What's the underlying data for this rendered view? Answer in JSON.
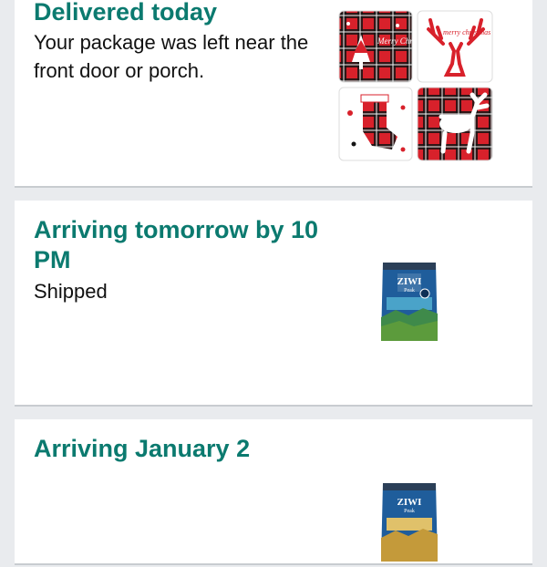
{
  "shipments": [
    {
      "status": "Delivered today",
      "detail": "Your package was left near the front door or porch.",
      "image": "christmas-pillow-covers"
    },
    {
      "status": "Arriving tomorrow by 10 PM",
      "detail": "Shipped",
      "image": "pet-food-bag-blue"
    },
    {
      "status": "Arriving January 2",
      "detail": "",
      "image": "pet-food-bag-blue"
    }
  ],
  "product_text": {
    "pillow_script_1": "Merry Christmas",
    "pillow_script_2": "merry christmas",
    "bag_brand": "ZIWI",
    "bag_subbrand": "Peak"
  },
  "colors": {
    "status_green": "#0b7a6f",
    "plaid_red": "#d8212b",
    "plaid_black": "#141414",
    "bag_blue": "#1f5d9b",
    "page_bg": "#e9ebee"
  }
}
